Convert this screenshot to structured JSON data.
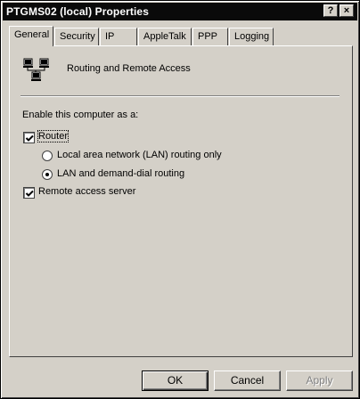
{
  "window": {
    "title": "PTGMS02 (local) Properties",
    "help_glyph": "?",
    "close_glyph": "×"
  },
  "tabs": [
    {
      "label": "General",
      "active": true
    },
    {
      "label": "Security",
      "active": false
    },
    {
      "label": "IP",
      "active": false
    },
    {
      "label": "AppleTalk",
      "active": false
    },
    {
      "label": "PPP",
      "active": false
    },
    {
      "label": "Logging",
      "active": false
    }
  ],
  "general": {
    "service_icon": "network-computers-icon",
    "service_name": "Routing and Remote Access",
    "enable_label": "Enable this computer as a:",
    "router": {
      "label": "Router",
      "checked": true
    },
    "routing_options": [
      {
        "label": "Local area network (LAN) routing only",
        "selected": false
      },
      {
        "label": "LAN and demand-dial routing",
        "selected": true
      }
    ],
    "remote_access": {
      "label": "Remote access server",
      "checked": true
    }
  },
  "buttons": {
    "ok": "OK",
    "cancel": "Cancel",
    "apply": "Apply",
    "apply_enabled": false
  },
  "colors": {
    "dialog_face": "#d4d0c8",
    "titlebar": "#0a0a0a",
    "disabled_text": "#808080"
  }
}
